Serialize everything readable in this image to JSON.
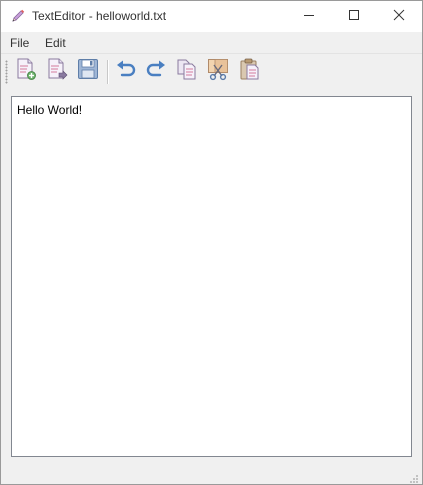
{
  "window": {
    "title": "TextEditor - helloworld.txt",
    "app_icon": "pencil-icon",
    "controls": {
      "minimize_icon": "minimize-icon",
      "maximize_icon": "maximize-icon",
      "close_icon": "close-icon"
    }
  },
  "menubar": {
    "items": [
      {
        "label": "File"
      },
      {
        "label": "Edit"
      }
    ]
  },
  "toolbar": {
    "buttons": [
      {
        "icon": "new-file-icon"
      },
      {
        "icon": "open-file-icon"
      },
      {
        "icon": "save-icon"
      },
      {
        "icon": "undo-icon"
      },
      {
        "icon": "redo-icon"
      },
      {
        "icon": "copy-icon"
      },
      {
        "icon": "cut-icon"
      },
      {
        "icon": "paste-icon"
      }
    ]
  },
  "editor": {
    "content": "Hello World!"
  },
  "colors": {
    "accent": "#4a7fc1",
    "frame": "#f0f0f0",
    "editor_bg": "#ffffff"
  }
}
